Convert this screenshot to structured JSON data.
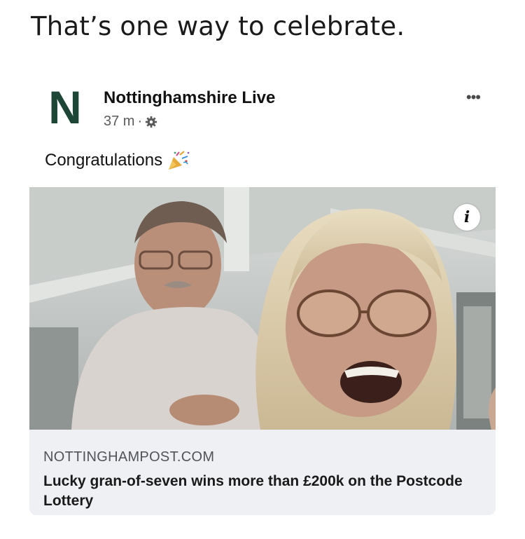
{
  "caption": "That’s one way to celebrate.",
  "post": {
    "avatar_letter": "N",
    "page_name": "Nottinghamshire Live",
    "time": "37 m",
    "separator": "·",
    "privacy_icon": "gear-icon",
    "more_icon": "more-options-icon",
    "more_glyph": "•••",
    "text": "Congratulations",
    "emoji": "party-popper-icon",
    "brand_color": "#1e4636"
  },
  "image": {
    "description_icon": "info-icon",
    "info_glyph": "i"
  },
  "link": {
    "domain": "NOTTINGHAMPOST.COM",
    "title": "Lucky gran-of-seven wins more than £200k on the Postcode Lottery"
  }
}
